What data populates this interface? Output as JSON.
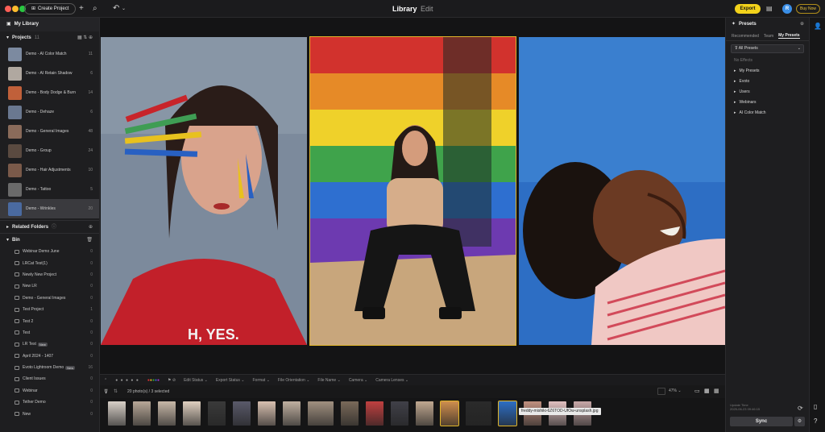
{
  "topbar": {
    "create_label": "Create Project",
    "tabs": [
      {
        "label": "Library"
      },
      {
        "label": "Edit"
      }
    ],
    "export_label": "Export",
    "buy_label": "Buy Now",
    "avatar_letter": "R",
    "traffic_colors": [
      "#ff5f57",
      "#febc2e",
      "#28c840"
    ]
  },
  "sidebar": {
    "library_title": "My Library",
    "projects": {
      "title": "Projects",
      "count": "11",
      "items": [
        {
          "label": "Demo - AI Color Match",
          "count": "11"
        },
        {
          "label": "Demo - AI Retain Shadow",
          "count": "6"
        },
        {
          "label": "Demo - Body Dodge & Burn",
          "count": "14"
        },
        {
          "label": "Demo - Dehaze",
          "count": "6"
        },
        {
          "label": "Demo - General Images",
          "count": "48"
        },
        {
          "label": "Demo - Group",
          "count": "24"
        },
        {
          "label": "Demo - Hair Adjustments",
          "count": "10"
        },
        {
          "label": "Demo - Tattoo",
          "count": "5"
        },
        {
          "label": "Demo - Wrinkles",
          "count": "20"
        }
      ]
    },
    "related_folders": {
      "title": "Related Folders"
    },
    "bin": {
      "title": "Bin",
      "items": [
        {
          "label": "Webinar Demo June",
          "count": "0",
          "badge": ""
        },
        {
          "label": "LRCat Test(1)",
          "count": "0",
          "badge": ""
        },
        {
          "label": "Newly New Project",
          "count": "0",
          "badge": ""
        },
        {
          "label": "New LR",
          "count": "0",
          "badge": ""
        },
        {
          "label": "Demo - General Images",
          "count": "0",
          "badge": ""
        },
        {
          "label": "Test Project",
          "count": "1",
          "badge": ""
        },
        {
          "label": "Test 2",
          "count": "0",
          "badge": ""
        },
        {
          "label": "Test",
          "count": "0",
          "badge": ""
        },
        {
          "label": "LR Test",
          "count": "0",
          "badge": "New"
        },
        {
          "label": "April 2024 - 1407",
          "count": "0",
          "badge": ""
        },
        {
          "label": "Evoto Lightroom Demo",
          "count": "16",
          "badge": "New"
        },
        {
          "label": "Client Issues",
          "count": "0",
          "badge": ""
        },
        {
          "label": "Webinar",
          "count": "0",
          "badge": ""
        },
        {
          "label": "Tether Demo",
          "count": "0",
          "badge": ""
        },
        {
          "label": "New",
          "count": "0",
          "badge": ""
        }
      ]
    }
  },
  "filmstrip": {
    "toolbar": [
      "Edit Status",
      "Export Status",
      "Format",
      "File Orientation",
      "File Name",
      "Camera",
      "Camera Lenses"
    ],
    "selection_text": "20 photo(s) / 3 selected",
    "zoom_text": "47%",
    "tooltip": "freddy-mishiki-6Z6TOD-UfOw-unsplash.jpg"
  },
  "presets": {
    "title": "Presets",
    "tabs": [
      {
        "label": "Recommended"
      },
      {
        "label": "Team"
      },
      {
        "label": "My Presets"
      }
    ],
    "select_value": "All Presets",
    "empty_text": "No Effects",
    "folders": [
      {
        "label": "My Presets"
      },
      {
        "label": "Evoto"
      },
      {
        "label": "Users"
      },
      {
        "label": "Webinars"
      },
      {
        "label": "AI Color Match"
      }
    ],
    "update_text": "Update Time",
    "update_date": "2025-06-23 09:46:15",
    "sync_label": "Sync"
  }
}
